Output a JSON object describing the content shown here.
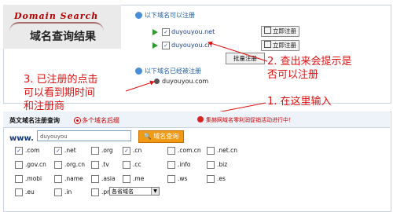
{
  "banner": {
    "title": "Domain Search",
    "subtitle": "域名查询结果"
  },
  "available": {
    "title": "以下域名可以注册",
    "items": [
      {
        "domain": "duyouyou.net",
        "checked": "✓",
        "button": "立即注册"
      },
      {
        "domain": "duyouyou.cn",
        "checked": "✓",
        "button": "立即注册"
      }
    ],
    "bulk_button": "批量注册"
  },
  "registered": {
    "title": "以下域名已经被注册",
    "items": [
      {
        "domain": "duyouyou.com"
      }
    ]
  },
  "annotations": {
    "note1": "1. 在这里输入",
    "note2_line1": "2. 查出来会提示是",
    "note2_line2": "否可以注册",
    "note3_line1": "3. 已注册的点击",
    "note3_line2": "可以看到期时间",
    "note3_line3": "和注册商"
  },
  "query": {
    "tab_label": "英文域名注册查询",
    "multi_label": "多个域名后缀",
    "promo": "集赫网域名零利润促销活动进行中！",
    "www_label": "www.",
    "input_value": "duyouyou",
    "search_button": "域名查询",
    "extensions": [
      [
        ".com",
        ".net",
        ".org",
        ".cn",
        ".com.cn",
        ".net.cn"
      ],
      [
        ".gov.cn",
        ".org.cn",
        ".tv",
        ".cc",
        ".info",
        ".biz"
      ],
      [
        ".mobi",
        ".name",
        ".asia",
        ".me",
        ".ws",
        ".es"
      ],
      [
        ".eu",
        ".in",
        ".pro"
      ]
    ],
    "checked_marks": [
      "✓",
      "✓",
      "✓"
    ],
    "province_select": "各省域名"
  },
  "colors": {
    "annotation_red": "#e01010",
    "link_blue": "#1b3f86",
    "accent_orange": "#f19a15"
  }
}
